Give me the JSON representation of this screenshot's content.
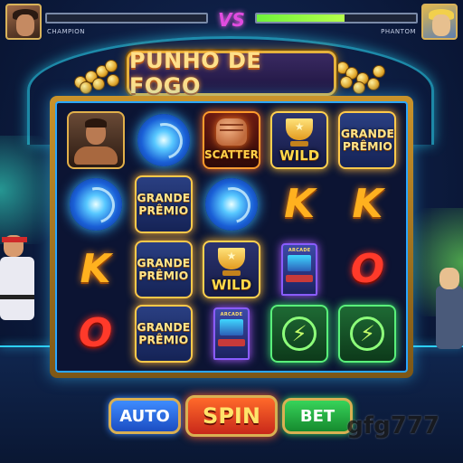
{
  "hud": {
    "player_left": {
      "name": "CHAMPION",
      "health": 0.0
    },
    "player_right": {
      "name": "PHANTOM",
      "health": 0.55
    },
    "vs_label": "VS"
  },
  "title": "PUNHO DE FOGO",
  "reels": {
    "columns": [
      [
        {
          "type": "fighter",
          "label": ""
        },
        {
          "type": "orb",
          "label": ""
        },
        {
          "type": "letter-k",
          "label": "K"
        },
        {
          "type": "letter-o",
          "label": "O"
        }
      ],
      [
        {
          "type": "orb",
          "label": ""
        },
        {
          "type": "grand",
          "label_line1": "GRANDE",
          "label_line2": "PRÊMIO"
        },
        {
          "type": "grand",
          "label_line1": "GRANDE",
          "label_line2": "PRÊMIO"
        },
        {
          "type": "grand",
          "label_line1": "GRANDE",
          "label_line2": "PRÊMIO"
        }
      ],
      [
        {
          "type": "scatter",
          "label": "SCATTER"
        },
        {
          "type": "orb",
          "label": ""
        },
        {
          "type": "wild",
          "label": "WILD"
        },
        {
          "type": "arcade",
          "label": "ARCADE"
        }
      ],
      [
        {
          "type": "wild",
          "label": "WILD"
        },
        {
          "type": "letter-k",
          "label": "K"
        },
        {
          "type": "arcade",
          "label": "ARCADE"
        },
        {
          "type": "bolt",
          "label": ""
        }
      ],
      [
        {
          "type": "grand",
          "label_line1": "GRANDE",
          "label_line2": "PRÊMIO"
        },
        {
          "type": "letter-k",
          "label": "K"
        },
        {
          "type": "letter-o",
          "label": "O"
        },
        {
          "type": "bolt",
          "label": ""
        }
      ]
    ]
  },
  "controls": {
    "auto_label": "AUTO",
    "spin_label": "SPIN",
    "bet_label": "BET"
  },
  "watermark": "gfg777",
  "colors": {
    "gold": "#e6b23c",
    "neon_blue": "#2aa6ff",
    "neon_green": "#59f07a",
    "spin_red": "#c8281a"
  }
}
